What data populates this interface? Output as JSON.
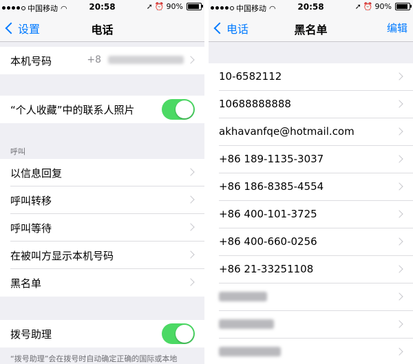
{
  "left": {
    "status": {
      "carrier": "中国移动",
      "time": "20:58",
      "battery": "90%",
      "battery_level": 0.9
    },
    "nav": {
      "back": "设置",
      "title": "电话"
    },
    "my_number": {
      "label": "本机号码",
      "value": "+8"
    },
    "contacts_photo": {
      "label": "“个人收藏”中的联系人照片",
      "on": true
    },
    "section_header": "呼叫",
    "call_items": [
      "以信息回复",
      "呼叫转移",
      "呼叫等待",
      "在被叫方显示本机号码",
      "黑名单"
    ],
    "dial_assist": {
      "label": "拨号助理",
      "on": true
    },
    "footer": "“拨号助理”会在拨号时自动确定正确的国际或本地"
  },
  "right": {
    "status": {
      "carrier": "中国移动",
      "time": "20:58",
      "battery": "90%",
      "battery_level": 0.9
    },
    "nav": {
      "back": "电话",
      "title": "黑名单",
      "action": "编辑"
    },
    "entries": [
      "10-6582112",
      "10688888888",
      "akhavanfqe@hotmail.com",
      "+86 189-1135-3037",
      "+86 186-8385-4554",
      "+86 400-101-3725",
      "+86 400-660-0256",
      "+86 21-33251108"
    ]
  },
  "colors": {
    "accent": "#007aff",
    "toggle_on": "#4cd964",
    "group_bg": "#efeff4"
  },
  "icons": [
    "signal-dots-icon",
    "wifi-icon",
    "location-icon",
    "alarm-icon",
    "battery-icon",
    "chevron-left-icon",
    "chevron-right-icon"
  ]
}
